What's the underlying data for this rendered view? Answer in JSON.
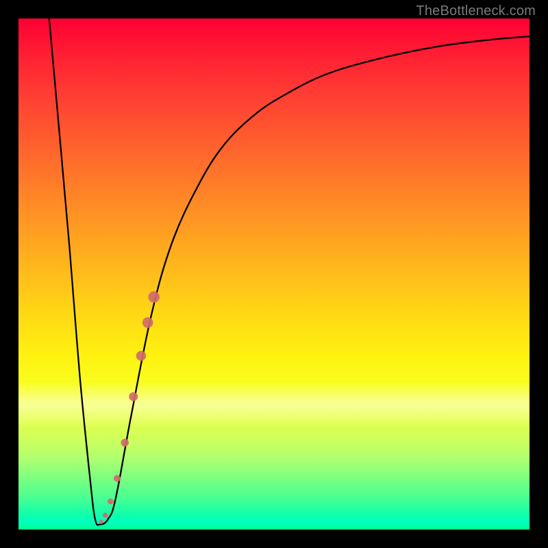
{
  "watermark": "TheBottleneck.com",
  "colors": {
    "frame": "#000000",
    "curve": "#000000",
    "marker": "#d16a6a",
    "gradient_top": "#ff0033",
    "gradient_bottom": "#00ff90"
  },
  "chart_data": {
    "type": "line",
    "title": "",
    "xlabel": "",
    "ylabel": "",
    "xlim": [
      0,
      100
    ],
    "ylim": [
      0,
      100
    ],
    "series": [
      {
        "name": "bottleneck-curve",
        "x": [
          6,
          10,
          12,
          14,
          15,
          16,
          17.5,
          19,
          22,
          26,
          30,
          35,
          40,
          46,
          52,
          60,
          70,
          82,
          92,
          100
        ],
        "values": [
          100,
          55,
          30,
          10,
          2,
          1,
          2,
          6,
          22,
          42,
          56,
          67,
          75,
          81,
          85,
          89,
          92,
          94.5,
          95.8,
          96.5
        ]
      }
    ],
    "markers": {
      "name": "highlight-segment",
      "x": [
        16.2,
        17.0,
        18.0,
        19.3,
        20.8,
        22.5,
        24.0,
        25.3,
        26.5
      ],
      "values": [
        1.5,
        2.8,
        5.5,
        10.0,
        17.0,
        26.0,
        34.0,
        40.5,
        45.5
      ],
      "size": [
        3.2,
        3.7,
        4.3,
        5.0,
        5.7,
        6.5,
        7.2,
        7.8,
        8.3
      ]
    }
  }
}
